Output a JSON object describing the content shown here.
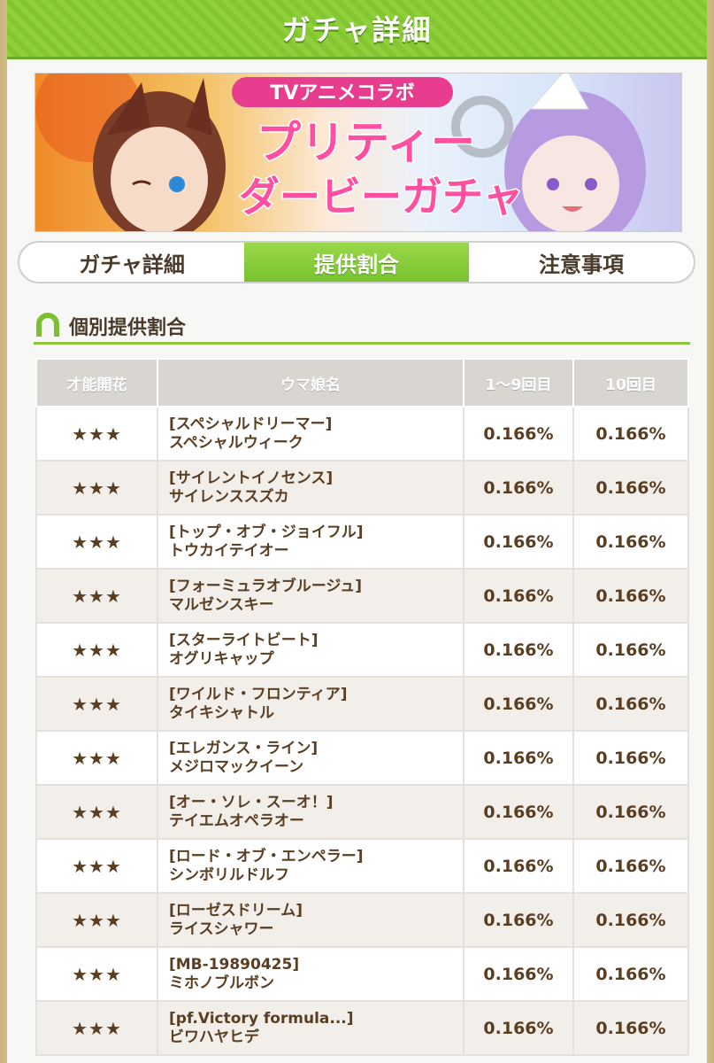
{
  "header": {
    "title": "ガチャ詳細"
  },
  "banner": {
    "tag": "TVアニメコラボ",
    "title_line1": "プリティー",
    "title_line2": "ダービーガチャ"
  },
  "tabs": [
    {
      "label": "ガチャ詳細",
      "active": false
    },
    {
      "label": "提供割合",
      "active": true
    },
    {
      "label": "注意事項",
      "active": false
    }
  ],
  "section": {
    "title": "個別提供割合"
  },
  "table": {
    "headers": [
      "才能開花",
      "ウマ娘名",
      "1～9回目",
      "10回目"
    ],
    "rows": [
      {
        "rarity": "★★★",
        "outfit": "[スペシャルドリーマー]",
        "name": "スペシャルウィーク",
        "rate_1_9": "0.166%",
        "rate_10": "0.166%"
      },
      {
        "rarity": "★★★",
        "outfit": "[サイレントイノセンス]",
        "name": "サイレンススズカ",
        "rate_1_9": "0.166%",
        "rate_10": "0.166%"
      },
      {
        "rarity": "★★★",
        "outfit": "[トップ・オブ・ジョイフル]",
        "name": "トウカイテイオー",
        "rate_1_9": "0.166%",
        "rate_10": "0.166%"
      },
      {
        "rarity": "★★★",
        "outfit": "[フォーミュラオブルージュ]",
        "name": "マルゼンスキー",
        "rate_1_9": "0.166%",
        "rate_10": "0.166%"
      },
      {
        "rarity": "★★★",
        "outfit": "[スターライトビート]",
        "name": "オグリキャップ",
        "rate_1_9": "0.166%",
        "rate_10": "0.166%"
      },
      {
        "rarity": "★★★",
        "outfit": "[ワイルド・フロンティア]",
        "name": "タイキシャトル",
        "rate_1_9": "0.166%",
        "rate_10": "0.166%"
      },
      {
        "rarity": "★★★",
        "outfit": "[エレガンス・ライン]",
        "name": "メジロマックイーン",
        "rate_1_9": "0.166%",
        "rate_10": "0.166%"
      },
      {
        "rarity": "★★★",
        "outfit": "[オー・ソレ・スーオ！]",
        "name": "テイエムオペラオー",
        "rate_1_9": "0.166%",
        "rate_10": "0.166%"
      },
      {
        "rarity": "★★★",
        "outfit": "[ロード・オブ・エンペラー]",
        "name": "シンボリルドルフ",
        "rate_1_9": "0.166%",
        "rate_10": "0.166%"
      },
      {
        "rarity": "★★★",
        "outfit": "[ローゼスドリーム]",
        "name": "ライスシャワー",
        "rate_1_9": "0.166%",
        "rate_10": "0.166%"
      },
      {
        "rarity": "★★★",
        "outfit": "[MB-19890425]",
        "name": "ミホノブルボン",
        "rate_1_9": "0.166%",
        "rate_10": "0.166%"
      },
      {
        "rarity": "★★★",
        "outfit": "[pf.Victory formula...]",
        "name": "ビワハヤヒデ",
        "rate_1_9": "0.166%",
        "rate_10": "0.166%"
      }
    ]
  }
}
